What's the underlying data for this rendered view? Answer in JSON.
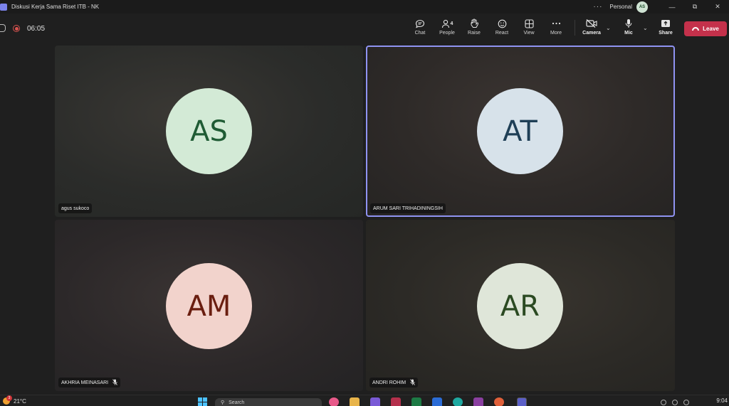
{
  "window": {
    "title": "Diskusi Kerja Sama Riset ITB - NK",
    "more": "···",
    "profile_label": "Personal",
    "profile_initials": "AS",
    "minimize": "—",
    "restore": "⧉",
    "close": "✕"
  },
  "meeting": {
    "timer": "06:05",
    "toolbar": {
      "chat": "Chat",
      "people": "People",
      "people_count": "4",
      "raise": "Raise",
      "react": "React",
      "view": "View",
      "more": "More",
      "camera": "Camera",
      "mic": "Mic",
      "share": "Share",
      "leave": "Leave"
    }
  },
  "participants": [
    {
      "initials": "AS",
      "name": "agus sukoco",
      "muted": false,
      "active_speaker": false
    },
    {
      "initials": "AT",
      "name": "ARUM SARI TRIHADININGSIH",
      "muted": false,
      "active_speaker": true
    },
    {
      "initials": "AM",
      "name": "AKHRIA MEINASARI",
      "muted": true,
      "active_speaker": false
    },
    {
      "initials": "AR",
      "name": "ANDRI ROHIM",
      "muted": true,
      "active_speaker": false
    }
  ],
  "icons": {
    "mic_off": "🎙︎"
  },
  "taskbar": {
    "temperature": "21°C",
    "weather_badge": "3",
    "search_placeholder": "Search",
    "clock": "9:04"
  },
  "colors": {
    "leave": "#c4314b",
    "active_border": "#8f93f2",
    "recording": "#d9534f"
  }
}
